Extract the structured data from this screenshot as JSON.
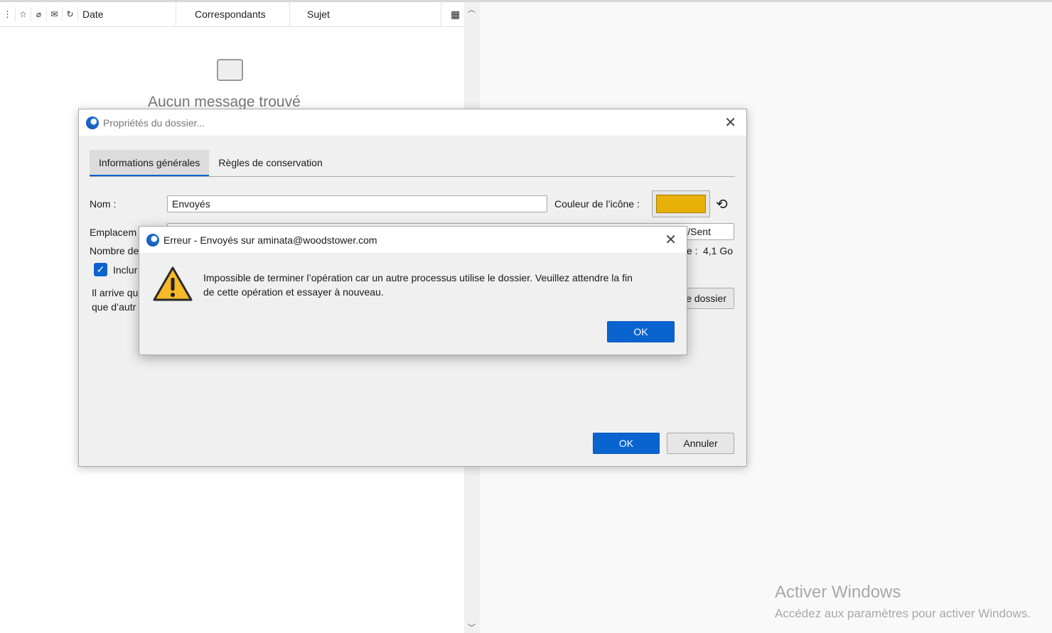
{
  "message_list": {
    "columns": {
      "date": "Date",
      "correspondents": "Correspondants",
      "subject": "Sujet"
    },
    "empty_text": "Aucun message trouvé"
  },
  "folder_dialog": {
    "title": "Propriétés du dossier...",
    "tabs": [
      "Informations générales",
      "Règles de conservation"
    ],
    "name_label": "Nom :",
    "name_value": "Envoyés",
    "icon_color_label": "Couleur de l’icône :",
    "icon_color": "#e8b008",
    "location_label": "Emplacem",
    "location_value": "/Sent",
    "count_label": "Nombre de",
    "size_suffix": "e :",
    "size_value": "4,1 Go",
    "include_label": "Inclur",
    "info_line1": "Il arrive qu",
    "info_line2": "que d’autr",
    "repair_button": "e dossier",
    "ok": "OK",
    "cancel": "Annuler"
  },
  "error_dialog": {
    "title": "Erreur - Envoyés sur aminata@woodstower.com",
    "message_line1": "Impossible de terminer l’opération car un autre processus utilise le dossier. Veuillez attendre la fin",
    "message_line2": "de cette opération et essayer à nouveau.",
    "ok": "OK"
  },
  "watermark": {
    "title": "Activer Windows",
    "subtitle": "Accédez aux paramètres pour activer Windows."
  }
}
